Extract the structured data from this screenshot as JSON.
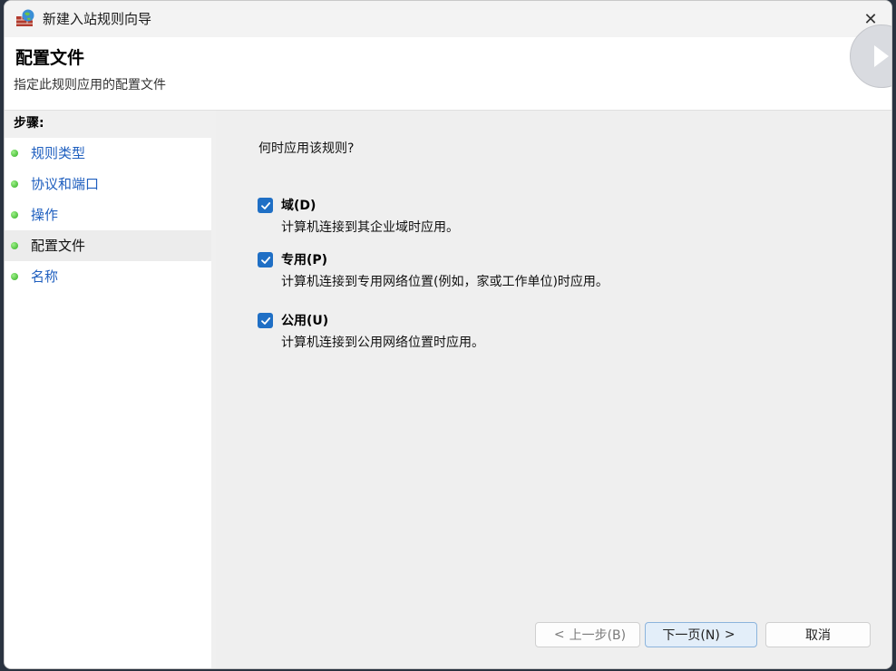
{
  "window": {
    "title": "新建入站规则向导"
  },
  "header": {
    "title": "配置文件",
    "subtitle": "指定此规则应用的配置文件"
  },
  "steps": {
    "heading": "步骤:",
    "items": [
      {
        "label": "规则类型"
      },
      {
        "label": "协议和端口"
      },
      {
        "label": "操作"
      },
      {
        "label": "配置文件"
      },
      {
        "label": "名称"
      }
    ]
  },
  "content": {
    "question": "何时应用该规则?",
    "options": [
      {
        "label": "域(D)",
        "description": "计算机连接到其企业域时应用。",
        "checked": true
      },
      {
        "label": "专用(P)",
        "description": "计算机连接到专用网络位置(例如，家或工作单位)时应用。",
        "checked": true
      },
      {
        "label": "公用(U)",
        "description": "计算机连接到公用网络位置时应用。",
        "checked": true
      }
    ]
  },
  "buttons": {
    "back": "上一步(B)",
    "next": "下一页(N)",
    "cancel": "取消"
  },
  "colors": {
    "accent": "#1f6fc5",
    "link": "#1f5fbf",
    "content_bg": "#efefef"
  }
}
